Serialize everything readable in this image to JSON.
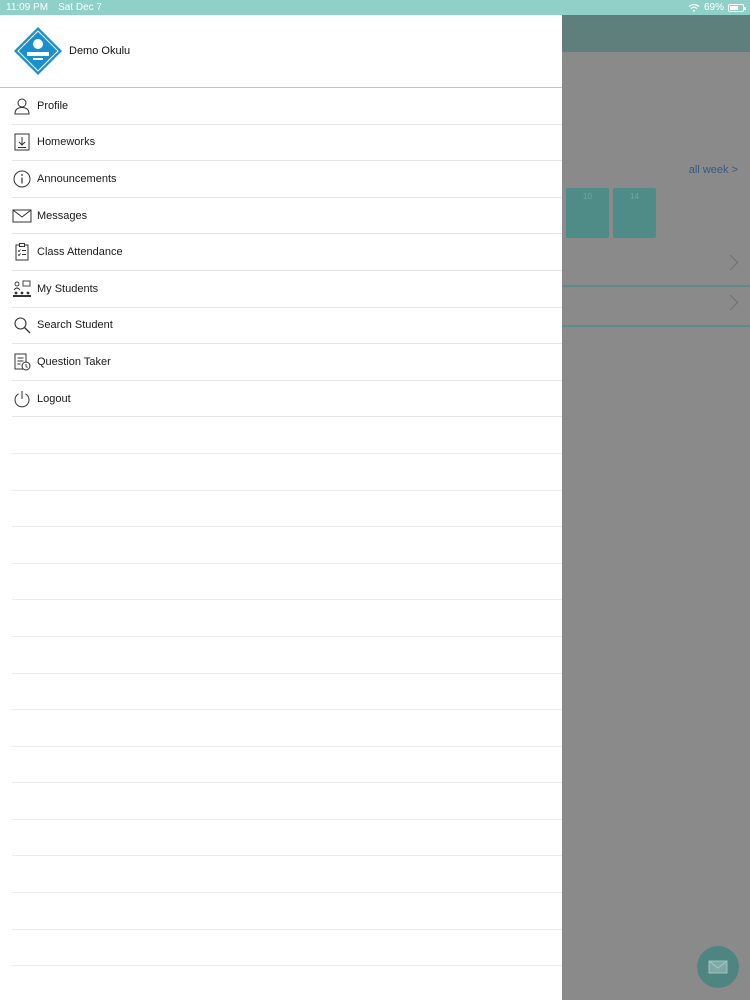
{
  "status_bar": {
    "time": "11:09 PM",
    "date": "Sat Dec 7",
    "battery": "69%",
    "battery_level": 0.69,
    "wifi_icon": "wifi-icon",
    "battery_icon": "battery-icon"
  },
  "background": {
    "all_week_link": "all week >",
    "day_cells": [
      "10",
      "14"
    ]
  },
  "drawer": {
    "school_name": "Demo Okulu",
    "menu": [
      {
        "label": "Profile",
        "icon": "person-icon"
      },
      {
        "label": "Homeworks",
        "icon": "download-book-icon"
      },
      {
        "label": "Announcements",
        "icon": "info-icon"
      },
      {
        "label": "Messages",
        "icon": "envelope-icon"
      },
      {
        "label": "Class Attendance",
        "icon": "clipboard-checklist-icon"
      },
      {
        "label": "My Students",
        "icon": "students-icon"
      },
      {
        "label": "Search Student",
        "icon": "search-icon"
      },
      {
        "label": "Question Taker",
        "icon": "question-sheet-icon"
      },
      {
        "label": "Logout",
        "icon": "power-icon"
      }
    ]
  },
  "colors": {
    "accent": "#8fd0c9",
    "logo_blue": "#1a8fd0",
    "overlay": "#8a8a8a"
  }
}
